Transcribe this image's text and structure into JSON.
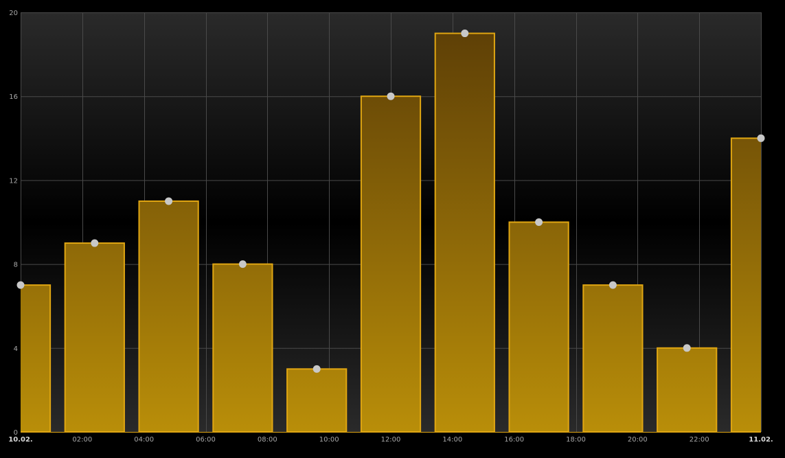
{
  "chart_data": {
    "type": "bar",
    "title": "",
    "xlabel": "",
    "ylabel": "",
    "x_tick_labels": [
      "10.02.",
      "02:00",
      "04:00",
      "06:00",
      "08:00",
      "10:00",
      "12:00",
      "14:00",
      "16:00",
      "18:00",
      "20:00",
      "22:00",
      "11.02."
    ],
    "x_tick_bold": [
      true,
      false,
      false,
      false,
      false,
      false,
      false,
      false,
      false,
      false,
      false,
      false,
      true
    ],
    "x_tick_hours": [
      0,
      2,
      4,
      6,
      8,
      10,
      12,
      14,
      16,
      18,
      20,
      22,
      24
    ],
    "x_range_hours": [
      0,
      24
    ],
    "y_ticks": [
      "0",
      "4",
      "8",
      "12",
      "16",
      "20"
    ],
    "y_tick_values": [
      0,
      4,
      8,
      12,
      16,
      20
    ],
    "ylim": [
      0,
      20
    ],
    "grid": true,
    "legend": "none",
    "bin_width_hours": 2.4,
    "series": [
      {
        "x_hours": [
          0,
          2.4,
          4.8,
          7.2,
          9.6,
          12.0,
          14.4,
          16.8,
          19.2,
          21.6,
          24.0
        ],
        "values": [
          7,
          9,
          11,
          8,
          3,
          16,
          19,
          10,
          7,
          4,
          14
        ]
      }
    ],
    "colors": {
      "background_top": "#2a2a2a",
      "background_mid": "#000000",
      "background_bottom": "#2a2a2a",
      "grid": "#4a4a4a",
      "bar_top": "#5a3c06",
      "bar_bottom": "#b98e09",
      "bar_stroke": "#e0a612",
      "marker": "#c8c8c8",
      "tick_text": "#a8a8a8",
      "tick_text_bold": "#d8d8d8"
    }
  }
}
